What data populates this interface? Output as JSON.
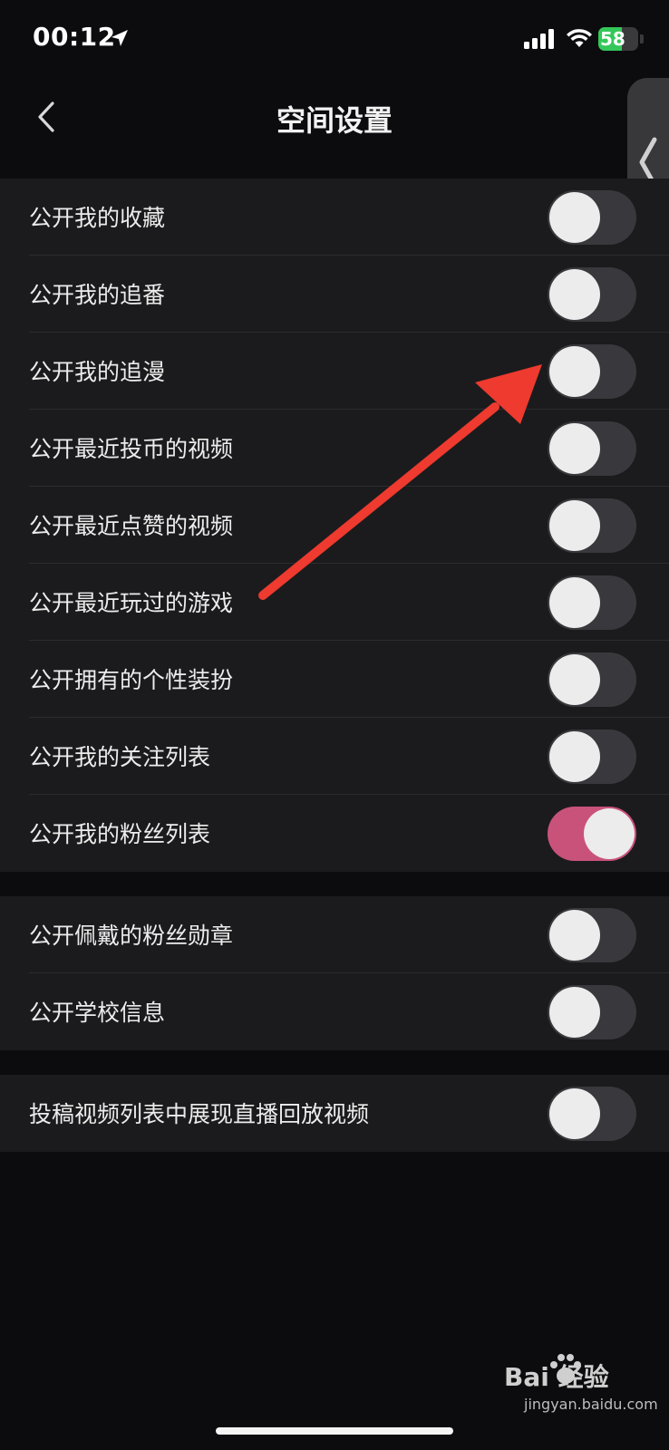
{
  "status_bar": {
    "time": "00:12",
    "battery_level": 58,
    "battery_text": "58",
    "battery_color": "#34c759",
    "icons": [
      "location-arrow-icon",
      "signal-bars-icon",
      "wifi-icon",
      "battery-charging-icon"
    ]
  },
  "nav": {
    "title": "空间设置",
    "back_icon": "chevron-left-icon"
  },
  "side_handle_icon": "chevron-left-icon",
  "groups": [
    {
      "items": [
        {
          "label": "公开我的收藏",
          "on": false
        },
        {
          "label": "公开我的追番",
          "on": false
        },
        {
          "label": "公开我的追漫",
          "on": false
        },
        {
          "label": "公开最近投币的视频",
          "on": false
        },
        {
          "label": "公开最近点赞的视频",
          "on": false
        },
        {
          "label": "公开最近玩过的游戏",
          "on": false
        },
        {
          "label": "公开拥有的个性装扮",
          "on": false
        },
        {
          "label": "公开我的关注列表",
          "on": false
        },
        {
          "label": "公开我的粉丝列表",
          "on": true
        }
      ]
    },
    {
      "items": [
        {
          "label": "公开佩戴的粉丝勋章",
          "on": false
        },
        {
          "label": "公开学校信息",
          "on": false
        }
      ]
    },
    {
      "items": [
        {
          "label": "投稿视频列表中展现直播回放视频",
          "on": false
        }
      ]
    }
  ],
  "colors": {
    "toggle_on": "#c9527b",
    "toggle_off": "#39393d",
    "annotation_arrow": "#ee3a2f"
  },
  "annotation": {
    "type": "arrow",
    "points_to": "公开我的追漫"
  },
  "watermark": {
    "brand": "Bai 经验",
    "url": "jingyan.baidu.com"
  }
}
